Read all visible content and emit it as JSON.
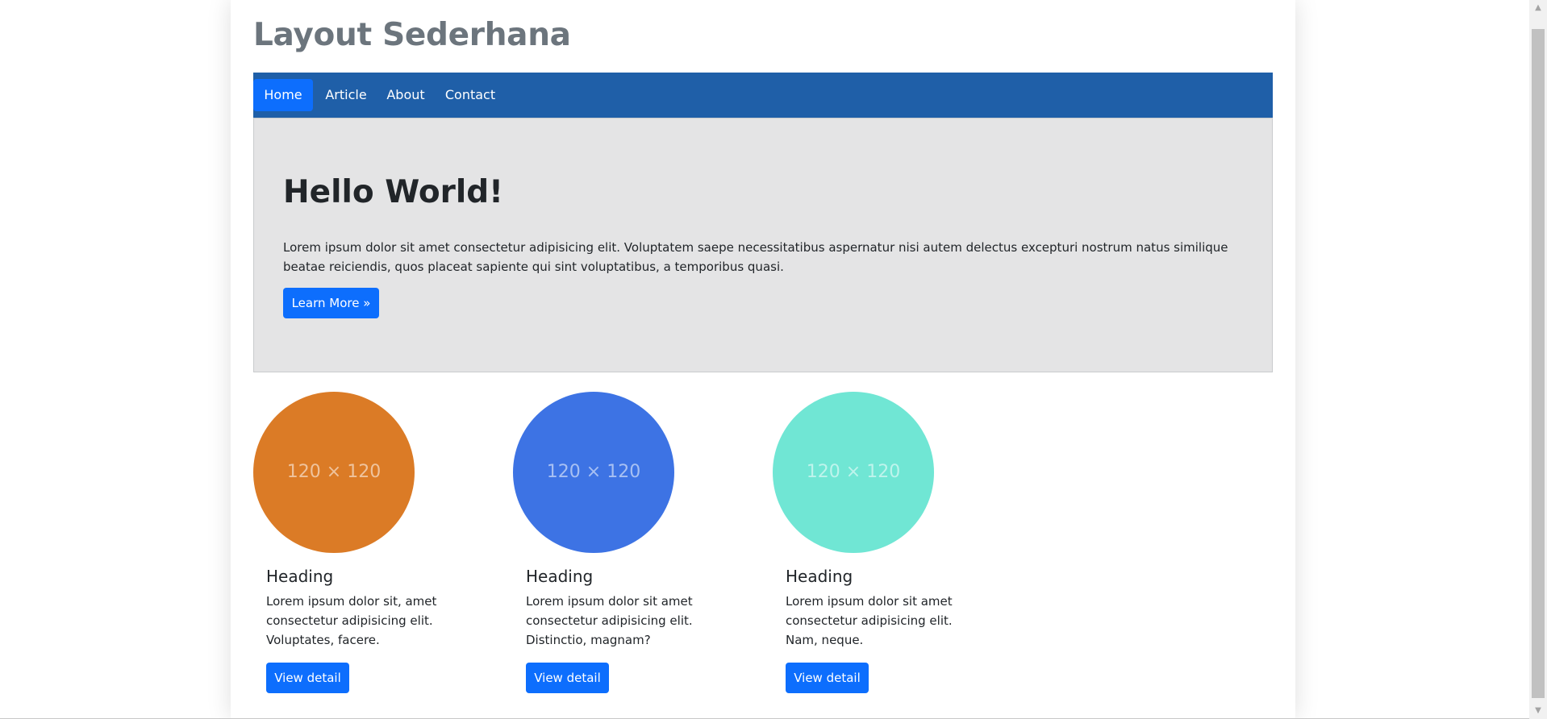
{
  "site": {
    "title": "Layout Sederhana"
  },
  "nav": {
    "items": [
      {
        "label": "Home",
        "active": true
      },
      {
        "label": "Article",
        "active": false
      },
      {
        "label": "About",
        "active": false
      },
      {
        "label": "Contact",
        "active": false
      }
    ]
  },
  "jumbotron": {
    "title": "Hello World!",
    "text": "Lorem ipsum dolor sit amet consectetur adipisicing elit. Voluptatem saepe necessitatibus aspernatur nisi autem delectus excepturi nostrum natus similique beatae reiciendis, quos placeat sapiente qui sint voluptatibus, a temporibus quasi.",
    "button_label": "Learn More »"
  },
  "cards": [
    {
      "placeholder": "120 × 120",
      "color": "#db7b26",
      "heading": "Heading",
      "text": "Lorem ipsum dolor sit, amet consectetur adipisicing elit. Voluptates, facere.",
      "button_label": "View detail"
    },
    {
      "placeholder": "120 × 120",
      "color": "#3d73e4",
      "heading": "Heading",
      "text": "Lorem ipsum dolor sit amet consectetur adipisicing elit. Distinctio, magnam?",
      "button_label": "View detail"
    },
    {
      "placeholder": "120 × 120",
      "color": "#70e6d4",
      "heading": "Heading",
      "text": "Lorem ipsum dolor sit amet consectetur adipisicing elit. Nam, neque.",
      "button_label": "View detail"
    }
  ],
  "colors": {
    "navbar": "#1f5fa8",
    "primary": "#0d6efd",
    "jumbotron_bg": "#e4e4e5",
    "title": "#6c757d"
  },
  "icons": {
    "scroll_up": "triangle-up-icon",
    "scroll_down": "triangle-down-icon"
  }
}
